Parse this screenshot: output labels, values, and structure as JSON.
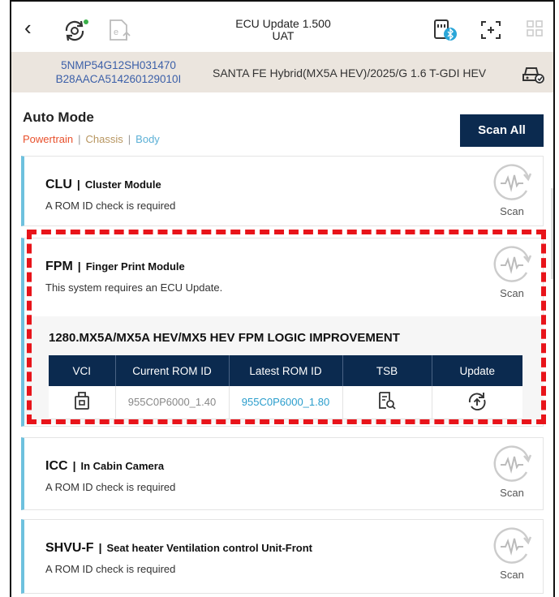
{
  "header": {
    "title_line1": "ECU Update 1.500",
    "title_line2": "UAT"
  },
  "vehicle": {
    "vin": "5NMP54G12SH031470",
    "id": "B28AACA514260129010I",
    "name": "SANTA FE Hybrid(MX5A HEV)/2025/G 1.6 T-GDI HEV"
  },
  "section": {
    "title": "Auto Mode",
    "filters": {
      "powertrain": "Powertrain",
      "chassis": "Chassis",
      "body": "Body",
      "sep": "|"
    },
    "scan_all": "Scan All"
  },
  "scan_label": "Scan",
  "modules": [
    {
      "code": "CLU",
      "name": "Cluster Module",
      "message": "A ROM ID check is required"
    },
    {
      "code": "FPM",
      "name": "Finger Print Module",
      "message": "This system requires an ECU Update."
    },
    {
      "code": "ICC",
      "name": "In Cabin Camera",
      "message": "A ROM ID check is required"
    },
    {
      "code": "SHVU-F",
      "name": "Seat heater Ventilation control Unit-Front",
      "message": "A ROM ID check is required"
    }
  ],
  "update": {
    "title": "1280.MX5A/MX5A HEV/MX5 HEV FPM LOGIC IMPROVEMENT",
    "columns": [
      "VCI",
      "Current ROM ID",
      "Latest ROM ID",
      "TSB",
      "Update"
    ],
    "row": {
      "current": "955C0P6000_1.40",
      "latest": "955C0P6000_1.80"
    }
  },
  "icons": {
    "back": "chevron-left-icon",
    "vci": "usb-device-icon",
    "tsb": "document-search-icon",
    "update": "update-arrow-icon",
    "scan": "scan-waveform-icon"
  },
  "colors": {
    "navy": "#0b2a4f",
    "accent_blue": "#6ec1de",
    "powertrain": "#e8502c",
    "chassis": "#b7955f",
    "body": "#5cb0d6",
    "highlight": "#e8141a",
    "latest_rom": "#2a9dcc"
  }
}
